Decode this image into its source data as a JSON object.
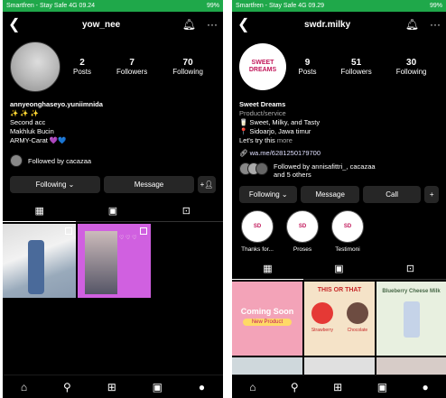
{
  "left": {
    "status": {
      "carrier": "Smartfren - Stay Safe 4G",
      "time": "09.24",
      "battery": "99%"
    },
    "username": "yow_nee",
    "stats": [
      {
        "num": "2",
        "label": "Posts"
      },
      {
        "num": "7",
        "label": "Followers"
      },
      {
        "num": "70",
        "label": "Following"
      }
    ],
    "bio": {
      "name": "annyeonghaseyo.yuniimnida",
      "lines": [
        "✨ ✨ ✨",
        "Second acc",
        "Makhluk Bucin",
        "ARMY-Carat 💜💙"
      ]
    },
    "followed_by": "Followed by cacazaa",
    "buttons": {
      "following": "Following ⌄",
      "message": "Message"
    },
    "colors": {
      "post2": "#d060e0"
    }
  },
  "right": {
    "status": {
      "carrier": "Smartfren - Stay Safe 4G",
      "time": "09.29",
      "battery": "99%"
    },
    "username": "swdr.milky",
    "avatar_text": [
      "SWEET",
      "DREAMS"
    ],
    "stats": [
      {
        "num": "9",
        "label": "Posts"
      },
      {
        "num": "51",
        "label": "Followers"
      },
      {
        "num": "30",
        "label": "Following"
      }
    ],
    "bio": {
      "name": "Sweet Dreams",
      "category": "Product/service",
      "lines": [
        "🥛 Sweet, Milky, and Tasty",
        "📍 Sidoarjo, Jawa timur"
      ],
      "more_prefix": "Let's try this",
      "more": "more",
      "link": "wa.me/6281250179700"
    },
    "followed_by_1": "Followed by annisafittri_, cacazaa",
    "followed_by_2": "and 5 others",
    "buttons": {
      "following": "Following ⌄",
      "message": "Message",
      "call": "Call"
    },
    "highlights": [
      "Thanks for...",
      "Proses",
      "Testimoni"
    ],
    "posts": {
      "p1_title": "Coming Soon",
      "p1_sub": "New Product",
      "p2_title": "THIS OR THAT",
      "p2_a": "Strawberry",
      "p2_b": "Chocolate",
      "p3_title": "Blueberry Cheese Milk"
    }
  }
}
